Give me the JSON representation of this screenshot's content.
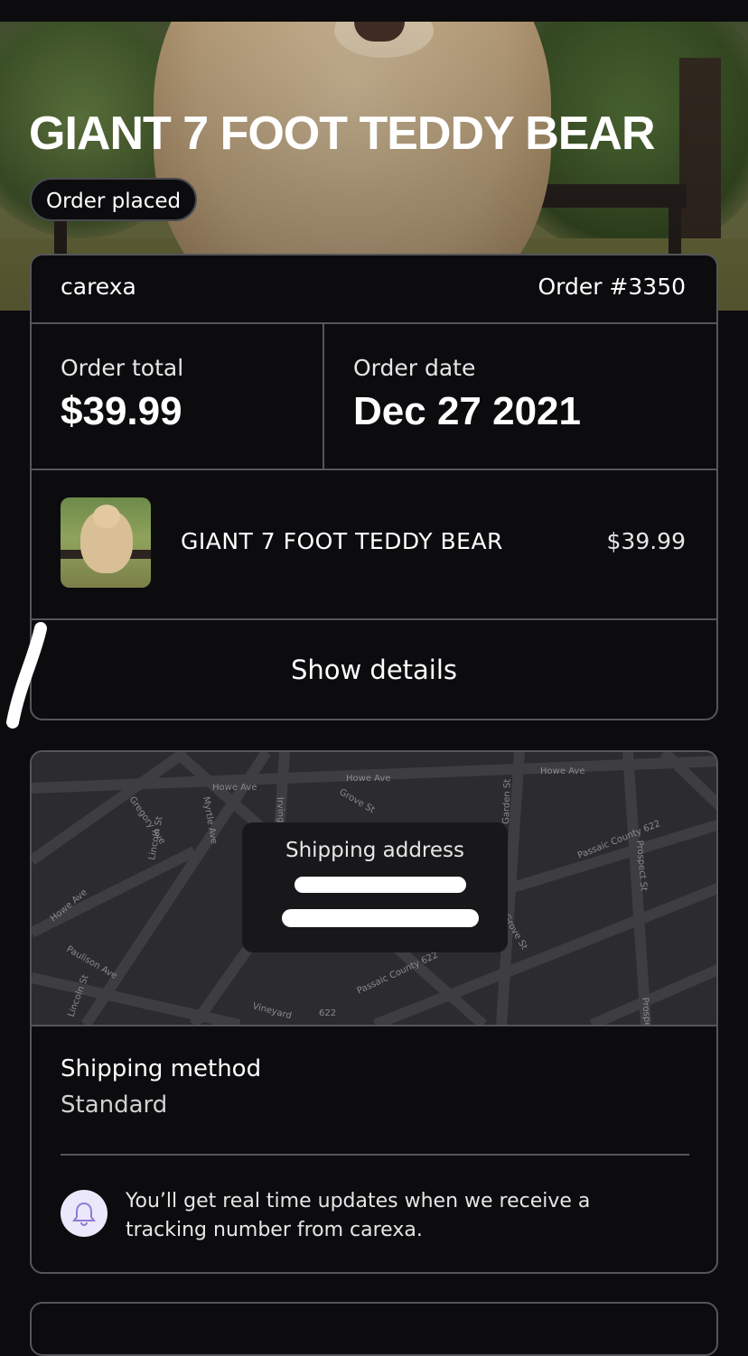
{
  "product": {
    "title": "GIANT 7 FOOT TEDDY BEAR",
    "status": "Order placed"
  },
  "order": {
    "store": "carexa",
    "number": "Order #3350",
    "total_label": "Order total",
    "total_value": "$39.99",
    "date_label": "Order date",
    "date_value": "Dec 27 2021",
    "item_name": "GIANT 7 FOOT TEDDY BEAR",
    "item_price": "$39.99",
    "show_details": "Show details"
  },
  "shipping": {
    "address_label": "Shipping address",
    "method_label": "Shipping method",
    "method_value": "Standard",
    "notice": "You’ll get real time updates when we receive a tracking number from carexa.",
    "map_streets": [
      "Howe Ave",
      "Howe Ave",
      "Howe Ave",
      "Grove St",
      "Gregory Ave",
      "Myrtle Ave",
      "Irving",
      "Garden St",
      "Passaic County 622",
      "Prospect St",
      "Lincoln St",
      "Howe Ave",
      "Paulison Ave",
      "Lincoln St",
      "Vineyard",
      "622",
      "Passaic County 622",
      "Grove St",
      "Prospe"
    ]
  },
  "icons": {
    "bell": "bell-icon"
  },
  "colors": {
    "background": "#0c0c0f",
    "border": "#55555b",
    "bell_bg": "#ece8fb",
    "bell_stroke": "#8e7ad6"
  }
}
